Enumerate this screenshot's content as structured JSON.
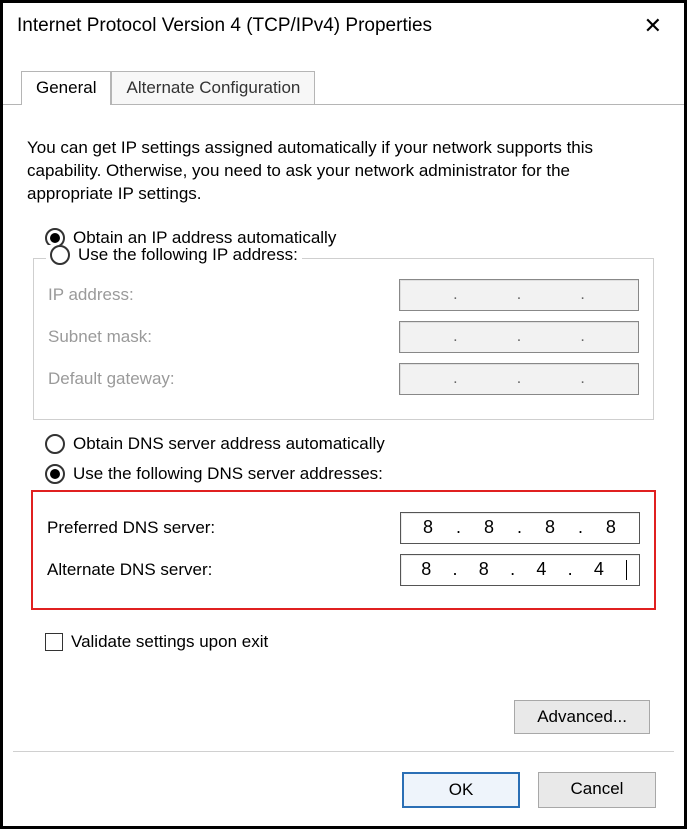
{
  "window": {
    "title": "Internet Protocol Version 4 (TCP/IPv4) Properties"
  },
  "tabs": {
    "general": "General",
    "alternate": "Alternate Configuration"
  },
  "intro": "You can get IP settings assigned automatically if your network supports this capability. Otherwise, you need to ask your network administrator for the appropriate IP settings.",
  "ip": {
    "auto_label": "Obtain an IP address automatically",
    "manual_label": "Use the following IP address:",
    "ip_address_label": "IP address:",
    "subnet_label": "Subnet mask:",
    "gateway_label": "Default gateway:"
  },
  "dns": {
    "auto_label": "Obtain DNS server address automatically",
    "manual_label": "Use the following DNS server addresses:",
    "preferred_label": "Preferred DNS server:",
    "alternate_label": "Alternate DNS server:",
    "preferred": {
      "a": "8",
      "b": "8",
      "c": "8",
      "d": "8"
    },
    "alternate": {
      "a": "8",
      "b": "8",
      "c": "4",
      "d": "4"
    }
  },
  "validate_label": "Validate settings upon exit",
  "buttons": {
    "advanced": "Advanced...",
    "ok": "OK",
    "cancel": "Cancel"
  }
}
